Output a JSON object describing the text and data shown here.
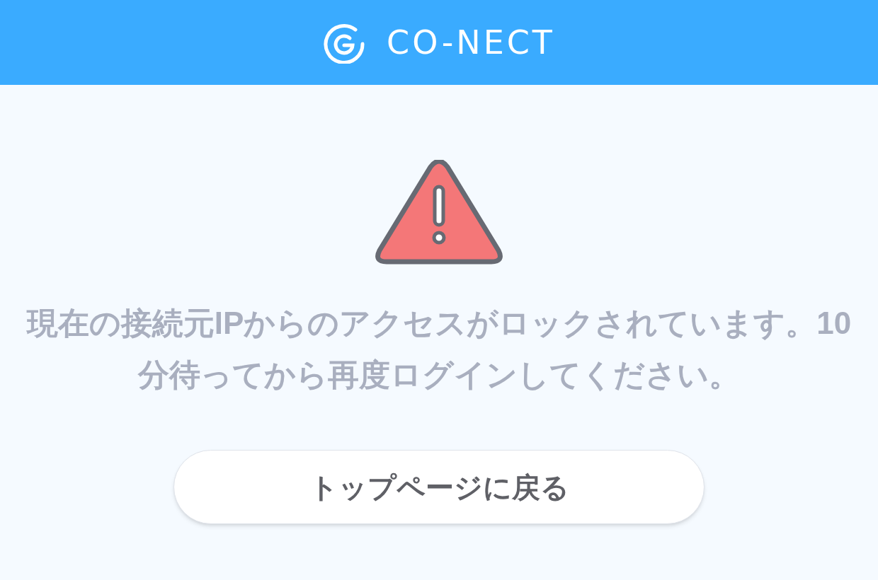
{
  "header": {
    "logo_text": "CO-NECT"
  },
  "alert": {
    "message": "現在の接続元IPからのアクセスがロックされています。10分待ってから再度ログインしてください。"
  },
  "buttons": [
    {
      "label": "トップページに戻る"
    }
  ]
}
